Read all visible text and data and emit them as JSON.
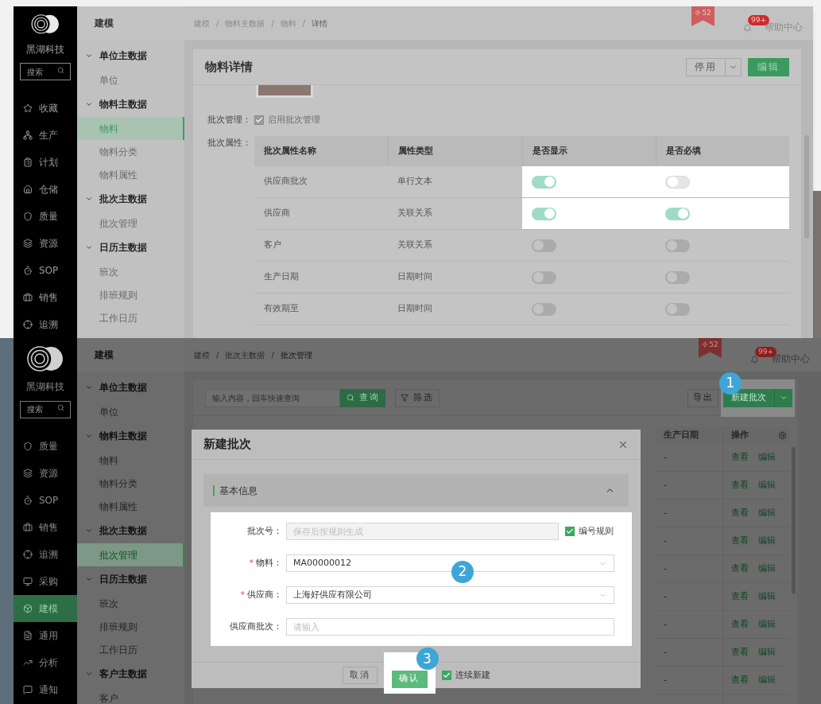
{
  "detail_screen": {
    "sidebar": {
      "brand": "黑湖科技",
      "search_placeholder": "搜索",
      "items": [
        {
          "label": "收藏",
          "selected": false
        },
        {
          "label": "生产",
          "selected": false
        },
        {
          "label": "计划",
          "selected": false
        },
        {
          "label": "仓储",
          "selected": false
        },
        {
          "label": "质量",
          "selected": false
        },
        {
          "label": "资源",
          "selected": false
        },
        {
          "label": "SOP",
          "selected": false
        },
        {
          "label": "销售",
          "selected": false
        },
        {
          "label": "追溯",
          "selected": false
        }
      ]
    },
    "nav": {
      "title": "建模",
      "groups": [
        {
          "label": "单位主数据",
          "expanded": true,
          "items": [
            {
              "label": "单位",
              "selected": false
            }
          ]
        },
        {
          "label": "物料主数据",
          "expanded": true,
          "items": [
            {
              "label": "物料",
              "selected": true
            },
            {
              "label": "物料分类",
              "selected": false
            },
            {
              "label": "物料属性",
              "selected": false
            }
          ]
        },
        {
          "label": "批次主数据",
          "expanded": true,
          "items": [
            {
              "label": "批次管理",
              "selected": false
            }
          ]
        },
        {
          "label": "日历主数据",
          "expanded": true,
          "items": [
            {
              "label": "班次",
              "selected": false
            },
            {
              "label": "排班规则",
              "selected": false
            },
            {
              "label": "工作日历",
              "selected": false
            }
          ]
        }
      ]
    },
    "header": {
      "breadcrumb": [
        "建模",
        "物料主数据",
        "物料",
        "详情"
      ],
      "separator": "/",
      "ribbon": "52",
      "notification_badge": "99+",
      "help": "帮助中心"
    },
    "card": {
      "title": "物料详情",
      "disable_button": "停用",
      "edit_button": "编辑",
      "batch_management": {
        "label": "批次管理：",
        "checked": true,
        "text": "启用批次管理"
      },
      "batch_attributes": {
        "label": "批次属性：",
        "columns": [
          "批次属性名称",
          "属性类型",
          "是否显示",
          "是否必填"
        ],
        "rows": [
          {
            "name": "供应商批次",
            "type": "单行文本",
            "show": true,
            "required": false,
            "highlighted": true
          },
          {
            "name": "供应商",
            "type": "关联关系",
            "show": true,
            "required": true,
            "highlighted": true
          },
          {
            "name": "客户",
            "type": "关联关系",
            "show": false,
            "required": false,
            "highlighted": false
          },
          {
            "name": "生产日期",
            "type": "日期时间",
            "show": false,
            "required": false,
            "highlighted": false
          },
          {
            "name": "有效期至",
            "type": "日期时间",
            "show": false,
            "required": false,
            "highlighted": false
          }
        ]
      }
    }
  },
  "list_screen": {
    "sidebar": {
      "brand": "黑湖科技",
      "search_placeholder": "搜索",
      "items": [
        {
          "label": "质量",
          "selected": false
        },
        {
          "label": "资源",
          "selected": false
        },
        {
          "label": "SOP",
          "selected": false
        },
        {
          "label": "销售",
          "selected": false
        },
        {
          "label": "追溯",
          "selected": false
        },
        {
          "label": "采购",
          "selected": false
        },
        {
          "label": "建模",
          "selected": true
        },
        {
          "label": "通用",
          "selected": false
        },
        {
          "label": "分析",
          "selected": false
        },
        {
          "label": "通知",
          "selected": false
        }
      ]
    },
    "nav": {
      "title": "建模",
      "groups": [
        {
          "label": "单位主数据",
          "expanded": true,
          "items": [
            {
              "label": "单位",
              "selected": false
            }
          ]
        },
        {
          "label": "物料主数据",
          "expanded": true,
          "items": [
            {
              "label": "物料",
              "selected": false
            },
            {
              "label": "物料分类",
              "selected": false
            },
            {
              "label": "物料属性",
              "selected": false
            }
          ]
        },
        {
          "label": "批次主数据",
          "expanded": true,
          "items": [
            {
              "label": "批次管理",
              "selected": true
            }
          ]
        },
        {
          "label": "日历主数据",
          "expanded": true,
          "items": [
            {
              "label": "班次",
              "selected": false
            },
            {
              "label": "排班规则",
              "selected": false
            },
            {
              "label": "工作日历",
              "selected": false
            }
          ]
        },
        {
          "label": "客户主数据",
          "expanded": true,
          "items": [
            {
              "label": "客户",
              "selected": false
            }
          ]
        }
      ]
    },
    "header": {
      "breadcrumb": [
        "建模",
        "批次主数据",
        "批次管理"
      ],
      "separator": "/",
      "ribbon": "52",
      "notification_badge": "99+",
      "help": "帮助中心"
    },
    "toolbar": {
      "search_placeholder": "输入内容，回车快速查询",
      "search_button": "查询",
      "filter_button": "筛选",
      "export_button": "导出",
      "create_button": "新建批次",
      "create_step": "1"
    },
    "table": {
      "columns": [
        "生产日期",
        "操作"
      ],
      "rows": [
        {
          "date": "-",
          "actions": [
            "查看",
            "编辑"
          ]
        },
        {
          "date": "-",
          "actions": [
            "查看",
            "编辑"
          ]
        },
        {
          "date": "-",
          "actions": [
            "查看",
            "编辑"
          ]
        },
        {
          "date": "-",
          "actions": [
            "查看",
            "编辑"
          ]
        },
        {
          "date": "-",
          "actions": [
            "查看",
            "编辑"
          ]
        },
        {
          "date": "-",
          "actions": [
            "查看",
            "编辑"
          ]
        },
        {
          "date": "-",
          "actions": [
            "查看",
            "编辑"
          ]
        },
        {
          "date": "-",
          "actions": [
            "查看",
            "编辑"
          ]
        },
        {
          "date": "-",
          "actions": [
            "查看",
            "编辑"
          ]
        }
      ]
    },
    "modal": {
      "title": "新建批次",
      "section": "基本信息",
      "section_expanded": true,
      "form_step": "2",
      "required_mark": "*",
      "fields": [
        {
          "kind": "input",
          "label": "批次号：",
          "required": false,
          "disabled": true,
          "placeholder": "保存后按规则生成",
          "checkbox": {
            "label": "编号规则",
            "checked": true
          }
        },
        {
          "kind": "select",
          "label": "物料：",
          "required": true,
          "value": "MA00000012"
        },
        {
          "kind": "select",
          "label": "供应商：",
          "required": true,
          "value": "上海好供应有限公司"
        },
        {
          "kind": "input",
          "label": "供应商批次：",
          "required": false,
          "disabled": false,
          "placeholder": "请输入"
        }
      ],
      "cancel_button": "取消",
      "confirm_button": "确认",
      "confirm_step": "3",
      "continue_checkbox": {
        "label": "连续新建",
        "checked": true
      }
    }
  }
}
